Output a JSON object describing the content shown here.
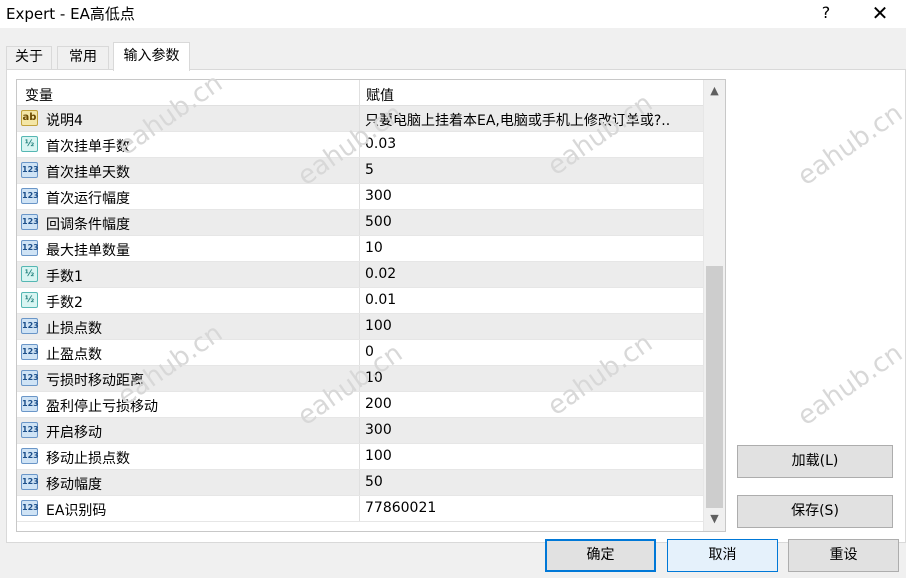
{
  "window": {
    "title": "Expert - EA高低点",
    "help_label": "?",
    "close_label": "✕"
  },
  "tabs": [
    {
      "label": "关于"
    },
    {
      "label": "常用"
    },
    {
      "label": "输入参数",
      "active": true
    }
  ],
  "grid": {
    "headers": {
      "variable": "变量",
      "value": "赋值"
    },
    "rows": [
      {
        "type": "str",
        "icon": "string-icon",
        "icon_text": "ab",
        "name": "说明4",
        "value": "只要电脑上挂着本EA,电脑或手机上修改订单或?.."
      },
      {
        "type": "dbl",
        "icon": "double-icon",
        "icon_text": "½",
        "name": "首次挂单手数",
        "value": "0.03"
      },
      {
        "type": "int",
        "icon": "integer-icon",
        "icon_text": "123",
        "name": "首次挂单天数",
        "value": "5"
      },
      {
        "type": "int",
        "icon": "integer-icon",
        "icon_text": "123",
        "name": "首次运行幅度",
        "value": "300"
      },
      {
        "type": "int",
        "icon": "integer-icon",
        "icon_text": "123",
        "name": "回调条件幅度",
        "value": "500"
      },
      {
        "type": "int",
        "icon": "integer-icon",
        "icon_text": "123",
        "name": "最大挂单数量",
        "value": "10"
      },
      {
        "type": "dbl",
        "icon": "double-icon",
        "icon_text": "½",
        "name": "手数1",
        "value": "0.02"
      },
      {
        "type": "dbl",
        "icon": "double-icon",
        "icon_text": "½",
        "name": "手数2",
        "value": "0.01"
      },
      {
        "type": "int",
        "icon": "integer-icon",
        "icon_text": "123",
        "name": "止损点数",
        "value": "100"
      },
      {
        "type": "int",
        "icon": "integer-icon",
        "icon_text": "123",
        "name": "止盈点数",
        "value": "0"
      },
      {
        "type": "int",
        "icon": "integer-icon",
        "icon_text": "123",
        "name": "亏损时移动距离",
        "value": "10"
      },
      {
        "type": "int",
        "icon": "integer-icon",
        "icon_text": "123",
        "name": "盈利停止亏损移动",
        "value": "200"
      },
      {
        "type": "int",
        "icon": "integer-icon",
        "icon_text": "123",
        "name": "开启移动",
        "value": "300"
      },
      {
        "type": "int",
        "icon": "integer-icon",
        "icon_text": "123",
        "name": "移动止损点数",
        "value": "100"
      },
      {
        "type": "int",
        "icon": "integer-icon",
        "icon_text": "123",
        "name": "移动幅度",
        "value": "50"
      },
      {
        "type": "int",
        "icon": "integer-icon",
        "icon_text": "123",
        "name": "EA识别码",
        "value": "77860021"
      }
    ]
  },
  "side_buttons": {
    "load_label": "加载(L)",
    "save_label": "保存(S)"
  },
  "footer_buttons": {
    "ok_label": "确定",
    "cancel_label": "取消",
    "reset_label": "重设"
  },
  "watermark": "eahub.cn"
}
